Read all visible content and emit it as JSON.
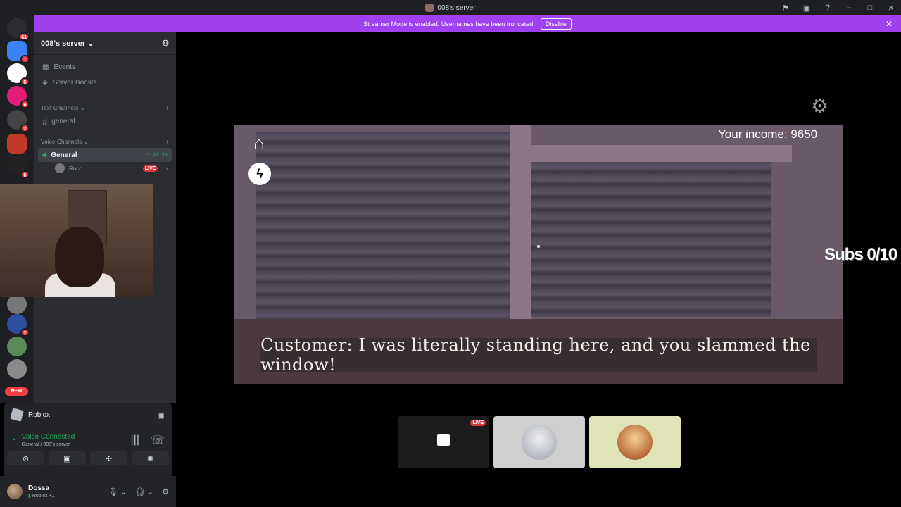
{
  "window": {
    "title": "008's server"
  },
  "banner": {
    "text": "Streamer Mode is enabled. Usernames have been truncated.",
    "button": "Disable"
  },
  "guilds": [
    {
      "badge": "61",
      "color": "#5865f2"
    },
    {
      "badge": "1",
      "color": "#3b82f6"
    },
    {
      "badge": "5",
      "color": "#ffffff"
    },
    {
      "badge": "6",
      "color": "#e11d74"
    },
    {
      "badge": "2",
      "color": "#555555"
    },
    {
      "badge": "",
      "color": "#c0392b"
    },
    {
      "badge": "6",
      "color": "#222222"
    }
  ],
  "guilds_bottom": [
    {
      "badge": "",
      "color": "#777777"
    },
    {
      "badge": "2",
      "color": "#2f4fa0"
    },
    {
      "badge": "",
      "color": "#5a8a5a"
    },
    {
      "badge": "",
      "color": "#8a8a8a"
    }
  ],
  "new_label": "NEW",
  "sidebar": {
    "server_name": "008's server",
    "nav": [
      {
        "label": "Events"
      },
      {
        "label": "Server Boosts"
      }
    ],
    "text_category": "Text Channels",
    "text_channels": [
      {
        "label": "general"
      }
    ],
    "voice_category": "Voice Channels",
    "voice_channel": {
      "label": "General",
      "timer": "5:47:55"
    },
    "member": {
      "name": "Rocc",
      "live": "LIVE"
    }
  },
  "activity": {
    "game": "Roblox"
  },
  "voice": {
    "status": "Voice Connected",
    "location": "General / 008's server"
  },
  "user": {
    "name": "Dossa",
    "status": "Roblox +1"
  },
  "game": {
    "income": "Your income: 9650",
    "subs": "Subs 0/10",
    "caption": "Customer: I was literally standing here, and you slammed the window!"
  },
  "tiles": {
    "live": "LIVE"
  },
  "colors": {
    "accent": "#a041f0",
    "connected": "#23a55a",
    "live": "#da373c"
  }
}
